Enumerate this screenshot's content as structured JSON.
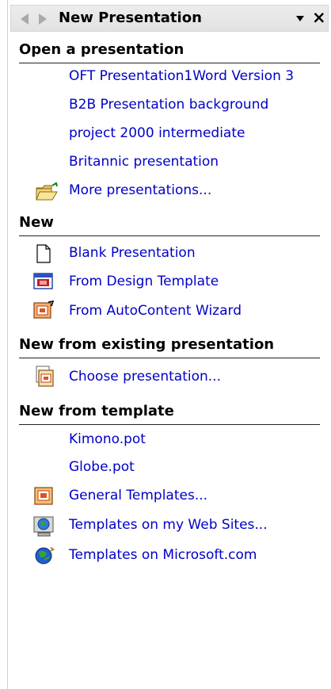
{
  "titlebar": {
    "title": "New Presentation",
    "back_icon": "back-arrow-icon",
    "forward_icon": "forward-arrow-icon",
    "menu_icon": "chevron-down-icon",
    "close_label": "×"
  },
  "sections": {
    "open": {
      "header": "Open a presentation",
      "items": [
        "OFT Presentation1Word Version 3",
        "B2B Presentation background",
        "project 2000 intermediate",
        "Britannic presentation"
      ],
      "more": "More presentations..."
    },
    "new": {
      "header": "New",
      "blank": "Blank Presentation",
      "design": "From Design Template",
      "wizard": "From AutoContent Wizard"
    },
    "existing": {
      "header": "New from existing presentation",
      "choose": "Choose presentation..."
    },
    "template": {
      "header": "New from template",
      "kimono": "Kimono.pot",
      "globe": "Globe.pot",
      "general": "General Templates...",
      "websites": "Templates on my Web Sites...",
      "microsoft": "Templates on Microsoft.com"
    }
  },
  "colors": {
    "link": "#0000c8",
    "titlebar": "#e6e6e6"
  }
}
